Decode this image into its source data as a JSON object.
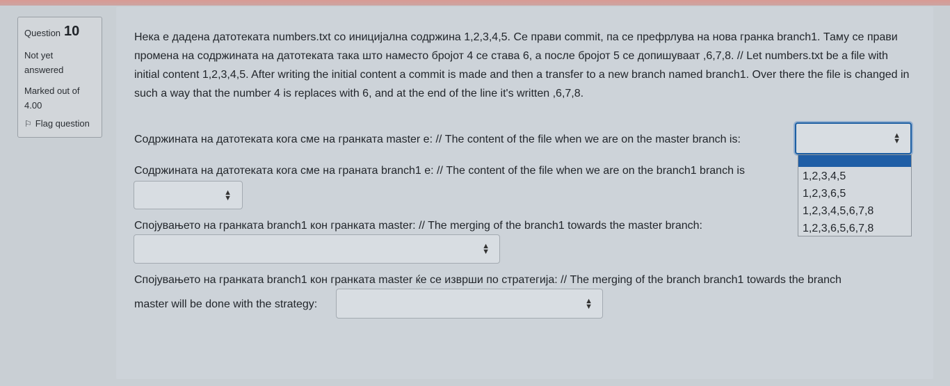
{
  "info": {
    "question_label": "Question",
    "question_number": "10",
    "state": "Not yet answered",
    "marks": "Marked out of 4.00",
    "flag_label": "Flag question"
  },
  "question": {
    "text": "Нека е дадена датотеката numbers.txt  со иницијална содржина 1,2,3,4,5. Се прави commit, па се префрлува на нова гранка branch1. Таму се прави промена на содржината на датотеката така што наместо бројот 4 се става 6, а после бројот 5 се допишуваат ,6,7,8. // Let numbers.txt be a file with initial content 1,2,3,4,5. After writing the initial content a commit is made and then a transfer to a new branch named branch1. Over there the file is changed in such a way that the number 4 is replaces with 6, and at the end of the line it's written ,6,7,8.",
    "prompt1": "Содржината на датотеката кога сме на гранката master е: // The content of the file when we are on the master branch is:",
    "prompt2": "Содржината на датотеката кога сме на граната branch1 е: // The content of the file when we are on the branch1 branch is",
    "prompt3": "Спојувањето на гранката branch1 кон гранката master: // The merging of the branch1 towards the master branch:",
    "prompt4_line1": "Спојувањето на гранката branch1 кон гранката master ќе се изврши по стратегија: // The merging of the branch branch1 towards the branch",
    "prompt4_line2": "master will be done with the strategy:"
  },
  "selects": {
    "master_content": "",
    "branch1_content": "",
    "merge": "",
    "strategy": ""
  },
  "dropdown": {
    "options": [
      "1,2,3,4,5",
      "1,2,3,6,5",
      "1,2,3,4,5,6,7,8",
      "1,2,3,6,5,6,7,8"
    ]
  }
}
